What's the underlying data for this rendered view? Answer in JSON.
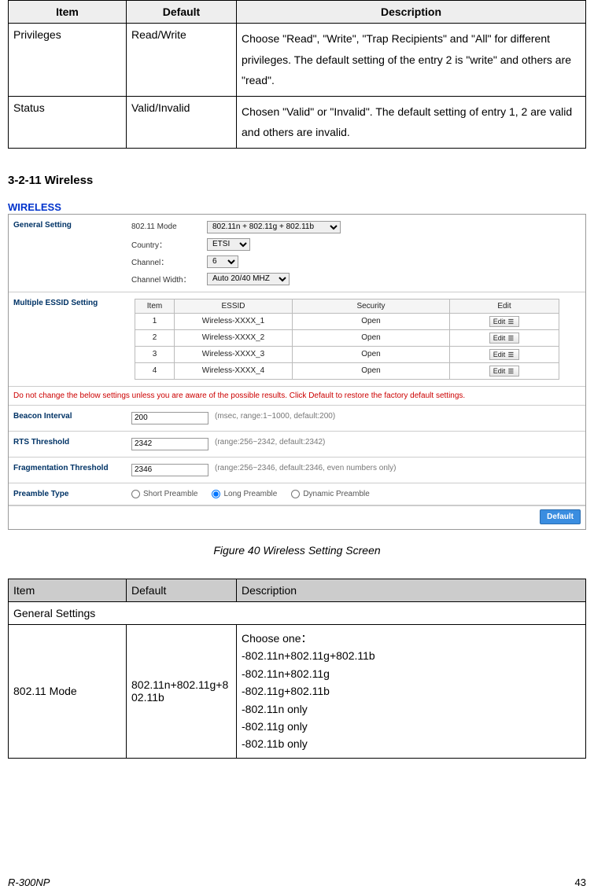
{
  "table1": {
    "headers": {
      "item": "Item",
      "default": "Default",
      "description": "Description"
    },
    "rows": [
      {
        "item": "Privileges",
        "default": "Read/Write",
        "description": "Choose \"Read\", \"Write\", \"Trap Recipients\" and \"All\" for different privileges. The default setting of the entry 2 is \"write\" and others are \"read\"."
      },
      {
        "item": "Status",
        "default": "Valid/Invalid",
        "description": "Chosen \"Valid\" or \"Invalid\". The default setting of entry 1, 2 are valid and others are invalid."
      }
    ]
  },
  "section_title": "3-2-11   Wireless",
  "wireless_heading": "WIRELESS",
  "general_setting": {
    "label": "General Setting",
    "mode_label": "802.11 Mode",
    "mode_value": "802.11n + 802.11g + 802.11b",
    "country_label": "Country：",
    "country_value": "ETSI",
    "channel_label": "Channel：",
    "channel_value": "6",
    "width_label": "Channel Width：",
    "width_value": "Auto 20/40 MHZ"
  },
  "essid": {
    "label": "Multiple ESSID Setting",
    "headers": {
      "item": "Item",
      "essid": "ESSID",
      "security": "Security",
      "edit": "Edit"
    },
    "rows": [
      {
        "item": "1",
        "essid": "Wireless-XXXX_1",
        "security": "Open",
        "edit": "Edit"
      },
      {
        "item": "2",
        "essid": "Wireless-XXXX_2",
        "security": "Open",
        "edit": "Edit"
      },
      {
        "item": "3",
        "essid": "Wireless-XXXX_3",
        "security": "Open",
        "edit": "Edit"
      },
      {
        "item": "4",
        "essid": "Wireless-XXXX_4",
        "security": "Open",
        "edit": "Edit"
      }
    ]
  },
  "warning": "Do not change the below settings unless you are aware of the possible results. Click Default to restore the factory default settings.",
  "beacon": {
    "label": "Beacon Interval",
    "value": "200",
    "hint": "(msec, range:1~1000, default:200)"
  },
  "rts": {
    "label": "RTS Threshold",
    "value": "2342",
    "hint": "(range:256~2342, default:2342)"
  },
  "frag": {
    "label": "Fragmentation Threshold",
    "value": "2346",
    "hint": "(range:256~2346, default:2346, even numbers only)"
  },
  "preamble": {
    "label": "Preamble Type",
    "options": {
      "short": "Short Preamble",
      "long": "Long Preamble",
      "dynamic": "Dynamic Preamble"
    },
    "selected": "long"
  },
  "default_button": "Default",
  "figure_caption": "Figure 40 Wireless Setting Screen",
  "table2": {
    "headers": {
      "item": "Item",
      "default": "Default",
      "description": "Description"
    },
    "section_row": "General Settings",
    "row": {
      "item": "802.11 Mode",
      "default": "802.11n+802.11g+802.11b",
      "desc_intro": "Choose one：",
      "desc_opts": [
        "-802.11n+802.11g+802.11b",
        "-802.11n+802.11g",
        "-802.11g+802.11b",
        "-802.11n only",
        "-802.11g only",
        "-802.11b only"
      ]
    }
  },
  "footer": {
    "model": "R-300NP",
    "page": "43"
  }
}
